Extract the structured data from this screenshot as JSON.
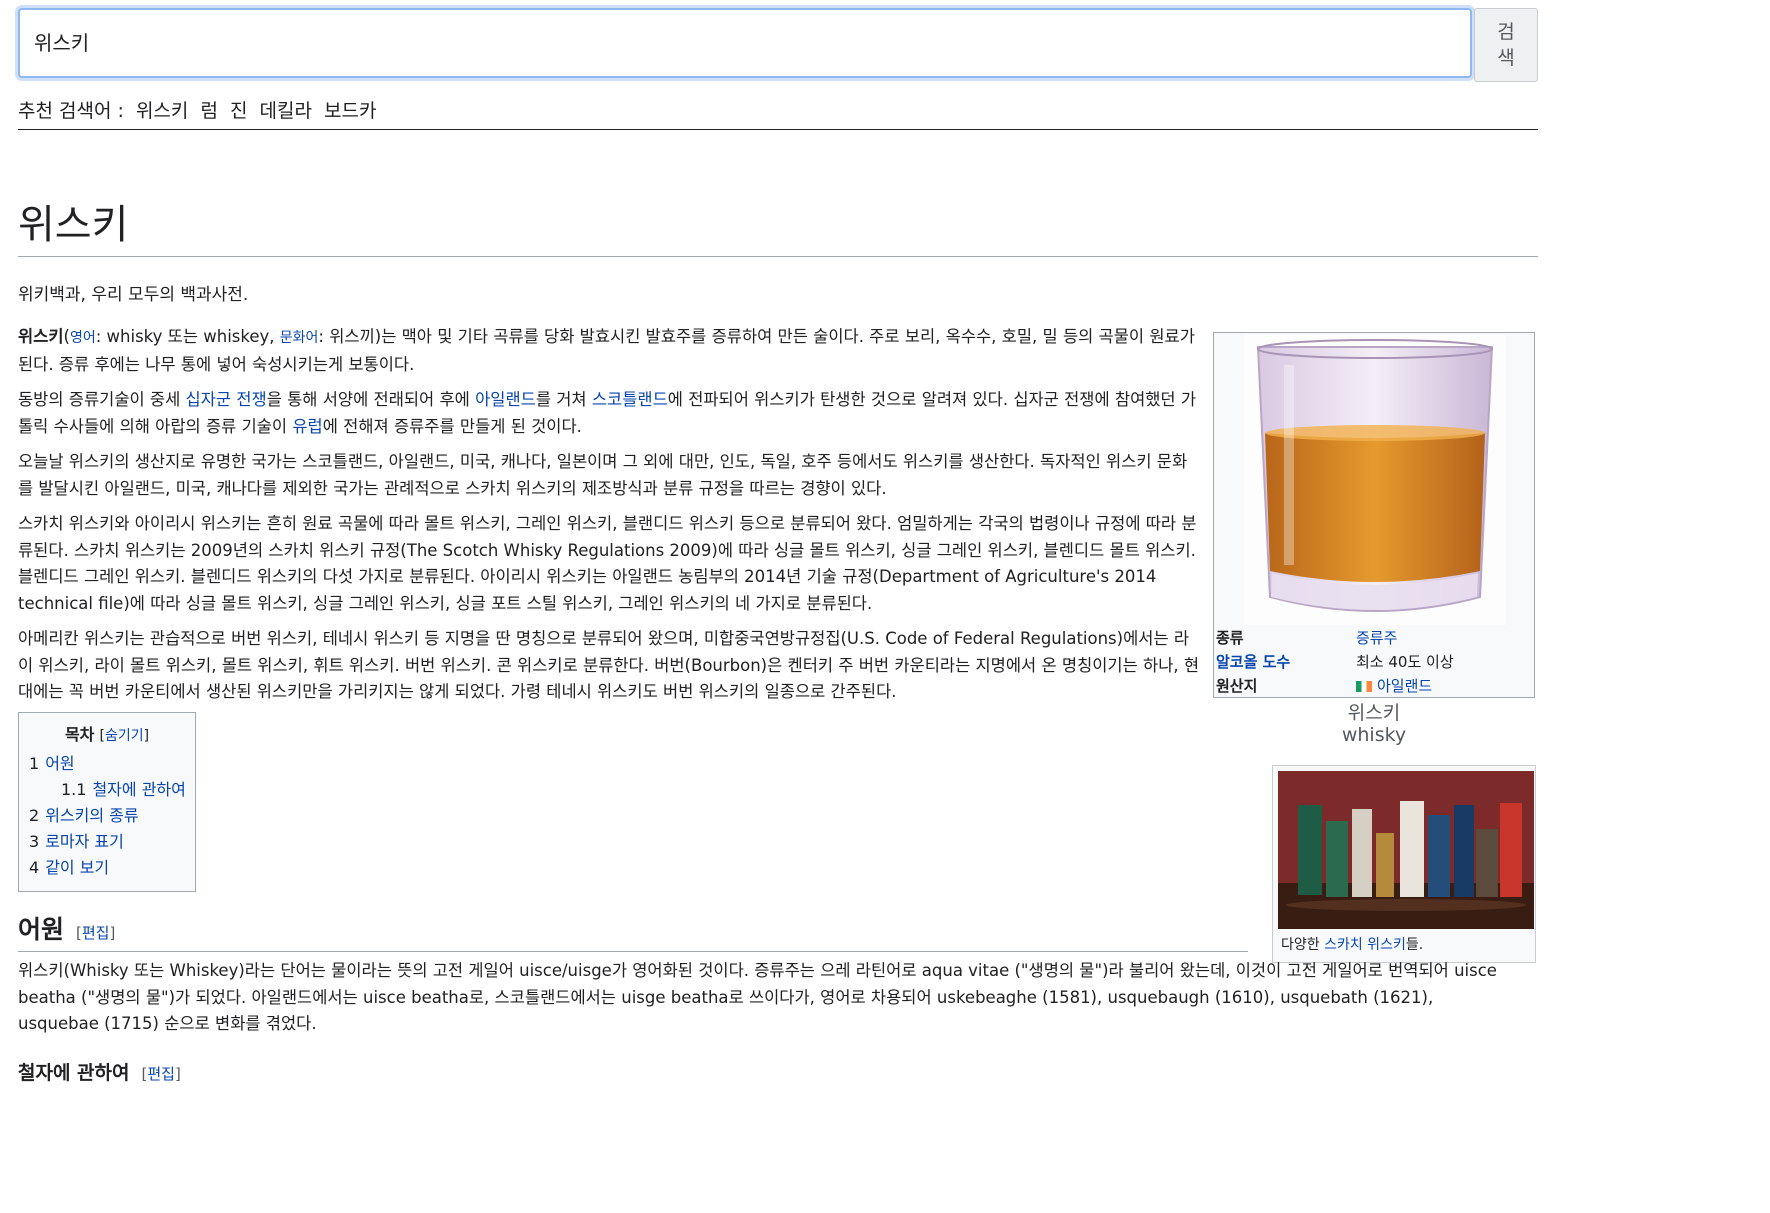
{
  "search": {
    "value": "위스키",
    "button_label_line1": "검",
    "button_label_line2": "색",
    "suggest_label": "추천 검색어 :",
    "suggestions": [
      "위스키",
      "럼",
      "진",
      "데킬라",
      "보드카"
    ]
  },
  "article": {
    "title": "위스키",
    "tagline": "위키백과, 우리 모두의 백과사전.",
    "p1": {
      "bold": "위스키",
      "open": "(",
      "lang1": "영어",
      "text1": ": whisky 또는 whiskey, ",
      "lang2": "문화어",
      "text2": ": 위스끼)는 맥아 및 기타 곡류를 당화 발효시킨 발효주를 증류하여 만든 술이다. 주로 보리, 옥수수, 호밀, 밀 등의 곡물이 원료가 된다. 증류 후에는 나무 통에 넣어 숙성시키는게 보통이다."
    },
    "p2": {
      "t1": "동방의 증류기술이 중세 ",
      "l1": "십자군 전쟁",
      "t2": "을 통해 서양에 전래되어 후에 ",
      "l2": "아일랜드",
      "t3": "를 거쳐 ",
      "l3": "스코틀랜드",
      "t4": "에 전파되어 위스키가 탄생한 것으로 알려져 있다. 십자군 전쟁에 참여했던 가톨릭 수사들에 의해 아랍의 증류 기술이 ",
      "l4": "유럽",
      "t5": "에 전해져 증류주를 만들게 된 것이다."
    },
    "p3": "오늘날 위스키의 생산지로 유명한 국가는 스코틀랜드, 아일랜드, 미국, 캐나다, 일본이며 그 외에 대만, 인도, 독일, 호주 등에서도 위스키를 생산한다. 독자적인 위스키 문화를 발달시킨 아일랜드, 미국, 캐나다를 제외한 국가는 관례적으로 스카치 위스키의 제조방식과 분류 규정을 따르는 경향이 있다.",
    "p4": "스카치 위스키와 아이리시 위스키는 흔히 원료 곡물에 따라 몰트 위스키, 그레인 위스키, 블랜디드 위스키 등으로 분류되어 왔다. 엄밀하게는 각국의 법령이나 규정에 따라 분류된다. 스카치 위스키는 2009년의 스카치 위스키 규정(The Scotch Whisky Regulations 2009)에 따라 싱글 몰트 위스키, 싱글 그레인 위스키, 블렌디드 몰트 위스키. 블렌디드 그레인 위스키. 블렌디드 위스키의 다섯 가지로 분류된다. 아이리시 위스키는 아일랜드 농림부의 2014년 기술 규정(Department of Agriculture's 2014 technical file)에 따라 싱글 몰트 위스키, 싱글 그레인 위스키, 싱글 포트 스틸 위스키, 그레인 위스키의 네 가지로 분류된다.",
    "p5": "아메리칸 위스키는 관습적으로 버번 위스키, 테네시 위스키 등 지명을 딴 명칭으로 분류되어 왔으며, 미합중국연방규정집(U.S. Code of Federal Regulations)에서는 라이 위스키, 라이 몰트 위스키, 몰트 위스키, 휘트 위스키. 버번 위스키. 콘 위스키로 분류한다. 버번(Bourbon)은 켄터키 주 버번 카운티라는 지명에서 온 명칭이기는 하나, 현대에는 꼭 버번 카운티에서 생산된 위스키만을 가리키지는 않게 되었다. 가령 테네시 위스키도 버번 위스키의 일종으로 간주된다."
  },
  "infobox": {
    "rows": [
      {
        "key": "종류",
        "value": "증류주"
      },
      {
        "key": "알코올 도수",
        "value": "최소 40도 이상"
      },
      {
        "key": "원산지",
        "value": "아일랜드"
      }
    ],
    "caption_line1": "위스키",
    "caption_line2": "whisky"
  },
  "thumb2": {
    "cap_pre": "다양한 ",
    "cap_link": "스카치 위스키",
    "cap_post": "들."
  },
  "toc": {
    "title": "목차",
    "hide_open": "[",
    "hide_label": "숨기기",
    "hide_close": "]",
    "items": [
      {
        "num": "1",
        "label": "어원"
      },
      {
        "num": "1.1",
        "label": "철자에 관하여"
      },
      {
        "num": "2",
        "label": "위스키의 종류"
      },
      {
        "num": "3",
        "label": "로마자 표기"
      },
      {
        "num": "4",
        "label": "같이 보기"
      }
    ]
  },
  "section1": {
    "heading": "어원",
    "edit_open": "[",
    "edit_label": "편집",
    "edit_close": "]",
    "text": "위스키(Whisky 또는 Whiskey)라는 단어는 물이라는 뜻의 고전 게일어 uisce/uisge가 영어화된 것이다. 증류주는 으레 라틴어로 aqua vitae (\"생명의 물\")라 불리어 왔는데, 이것이 고전 게일어로 번역되어 uisce beatha (\"생명의 물\")가 되었다. 아일랜드에서는 uisce beatha로, 스코틀랜드에서는 uisge beatha로 쓰이다가, 영어로 차용되어 uskebeaghe (1581), usquebaugh (1610), usquebath (1621), usquebae (1715) 순으로 변화를 겪었다."
  },
  "section2": {
    "heading": "철자에 관하여",
    "edit_open": "[",
    "edit_label": "편집",
    "edit_close": "]"
  },
  "colors": {
    "link": "#0645ad",
    "text": "#202122",
    "border": "#a2a9b1",
    "focus": "#8fb8f0"
  },
  "icons": {
    "flag": "ireland-flag-icon"
  }
}
